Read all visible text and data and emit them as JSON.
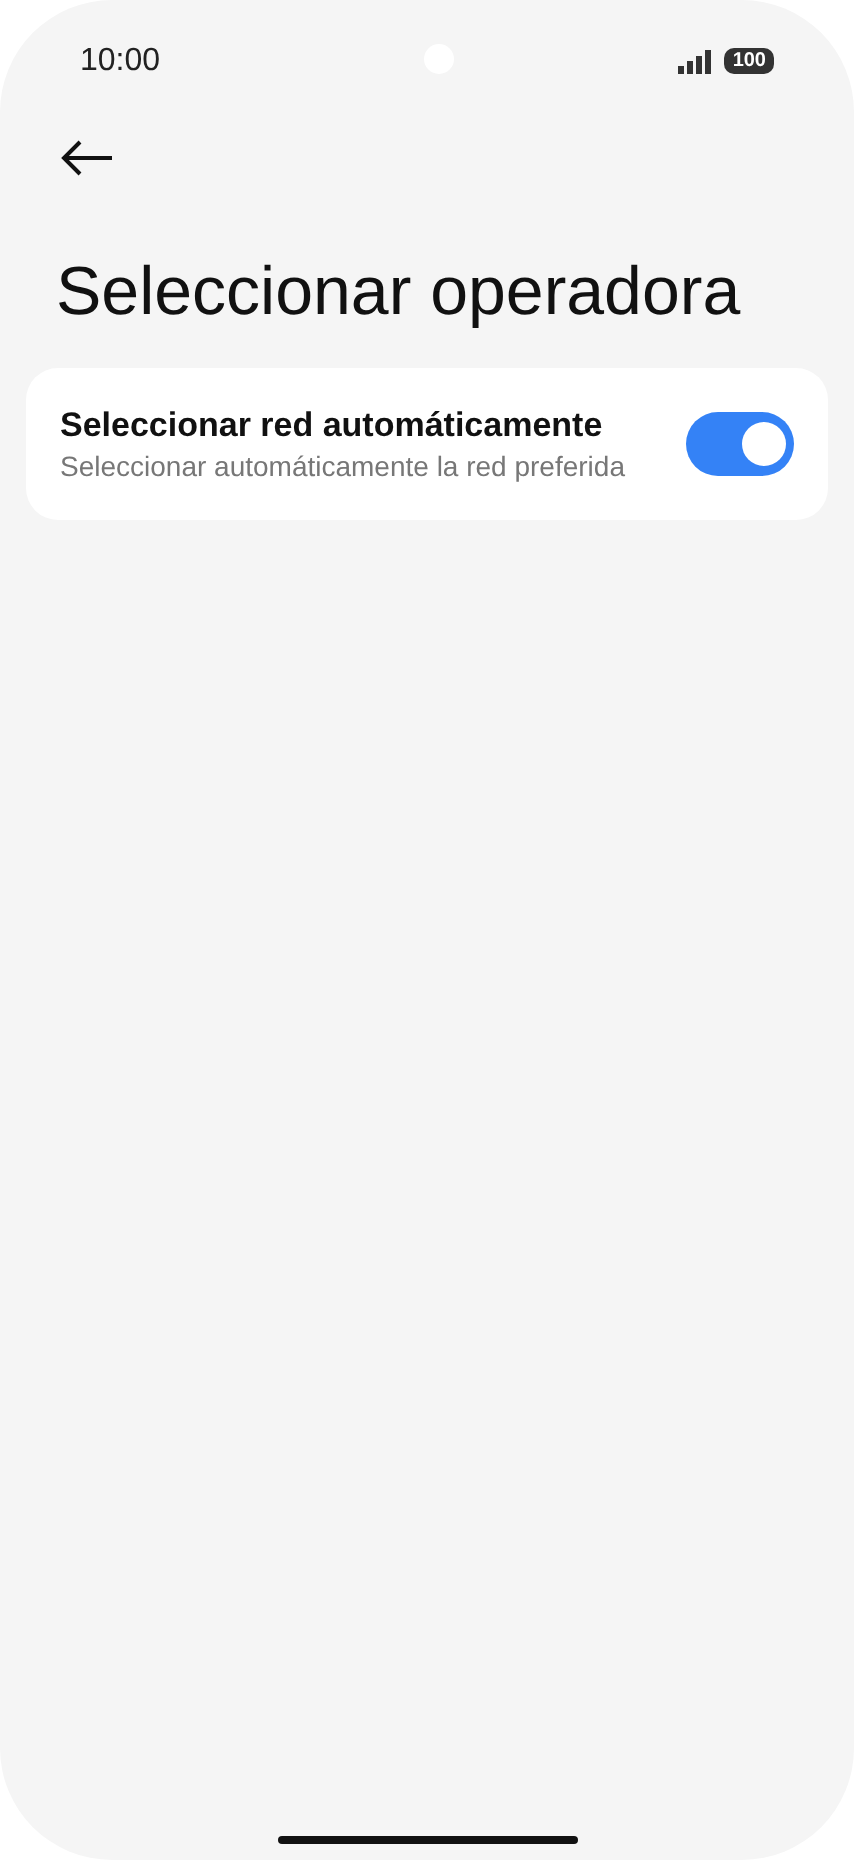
{
  "status_bar": {
    "time": "10:00",
    "battery": "100"
  },
  "title": "Seleccionar operadora",
  "settings": [
    {
      "kind": "switch",
      "title": "Seleccionar red automáticamente",
      "subtitle": "Seleccionar automáticamente la red preferida",
      "on": true
    }
  ]
}
